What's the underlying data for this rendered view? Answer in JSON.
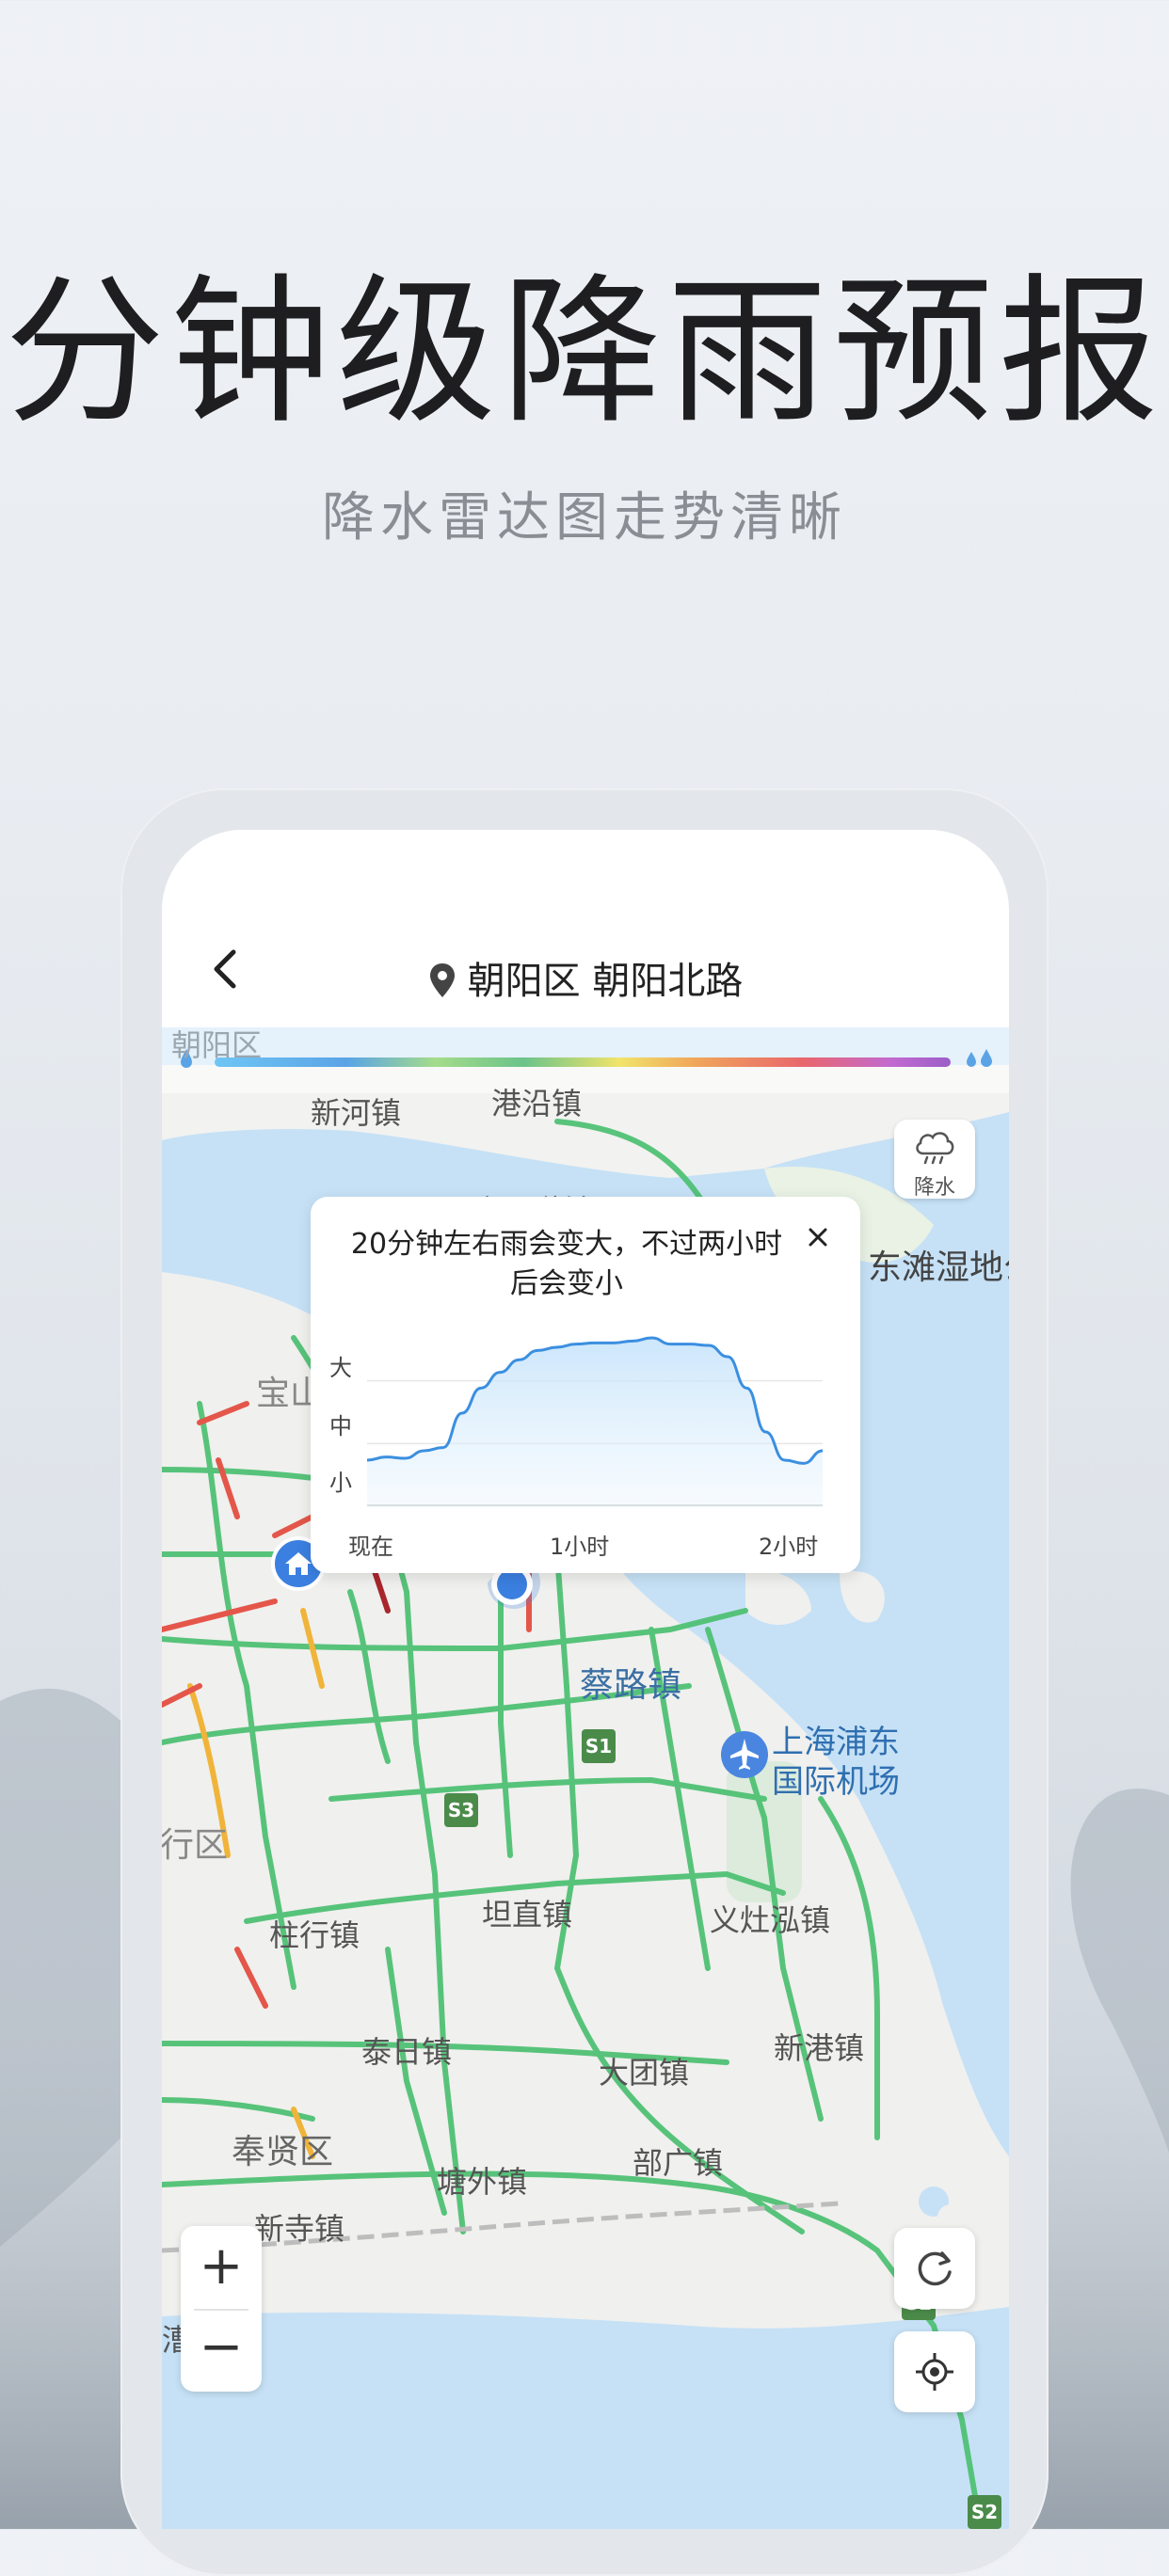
{
  "promo": {
    "headline": "分钟级降雨预报",
    "subheadline": "降水雷达图走势清晰"
  },
  "header": {
    "back_icon": "chevron-left-icon",
    "location_icon": "location-pin-icon",
    "location": "朝阳区 朝阳北路"
  },
  "radar": {
    "button_label": "降水",
    "button_icon": "cloud-rain-icon",
    "scale_colors": [
      "#6ec6f5",
      "#5aa4e6",
      "#a4dc8a",
      "#6bc38a",
      "#f1e46a",
      "#f0a75a",
      "#e9666d",
      "#c26ad1",
      "#9b5ec7"
    ]
  },
  "forecast_popup": {
    "message": "20分钟左右雨会变大，不过两小时后会变小",
    "close_icon": "close-icon",
    "y_levels": [
      "大",
      "中",
      "小"
    ],
    "x_ticks": [
      "现在",
      "1小时",
      "2小时"
    ]
  },
  "map": {
    "labels": {
      "xinhe": "新河镇",
      "gangyan": "港沿镇",
      "chenjia": "东滩湿地公",
      "baoshan": "宝山",
      "cailu": "蔡路镇",
      "airport_line1": "上海浦东",
      "airport_line2": "国际机场",
      "minhang": "行区",
      "zhuhang": "柱行镇",
      "tanzhi": "坦直镇",
      "yizhao": "义灶泓镇",
      "tairi": "泰日镇",
      "datuan": "大团镇",
      "xingang": "新港镇",
      "fengxian": "奉贤区",
      "tangwai": "塘外镇",
      "buguang": "部广镇",
      "xinsi": "新寺镇",
      "caojing": "漕泾镇",
      "chaoyang_faded": "朝阳区",
      "shangmiao": "高四澈镇"
    },
    "road_badges": [
      "S1",
      "S3",
      "S2",
      "S2"
    ],
    "home_icon": "home-marker-icon",
    "current_location_icon": "current-location-marker-icon",
    "selected_pin_icon": "red-location-pin-icon",
    "airport_icon": "airport-icon",
    "tulip_icon": "tulip-icon"
  },
  "controls": {
    "zoom_in": "+",
    "zoom_out": "−",
    "refresh_icon": "refresh-icon",
    "locate_icon": "locate-crosshair-icon"
  },
  "chart_data": {
    "type": "area",
    "title": "",
    "xlabel": "",
    "ylabel": "",
    "x_ticks": [
      "现在",
      "1小时",
      "2小时"
    ],
    "y_ticks": [
      "小",
      "中",
      "大"
    ],
    "ylim": [
      0,
      3
    ],
    "x": [
      0,
      5,
      10,
      15,
      20,
      25,
      30,
      35,
      40,
      45,
      50,
      55,
      60,
      65,
      70,
      75,
      80,
      85,
      90,
      95,
      100,
      105,
      110,
      115,
      120
    ],
    "series": [
      {
        "values": [
          0.75,
          0.8,
          0.78,
          0.9,
          0.95,
          1.5,
          1.9,
          2.15,
          2.35,
          2.5,
          2.55,
          2.6,
          2.62,
          2.62,
          2.65,
          2.7,
          2.6,
          2.6,
          2.58,
          2.4,
          1.9,
          1.2,
          0.75,
          0.7,
          0.9
        ]
      }
    ]
  }
}
